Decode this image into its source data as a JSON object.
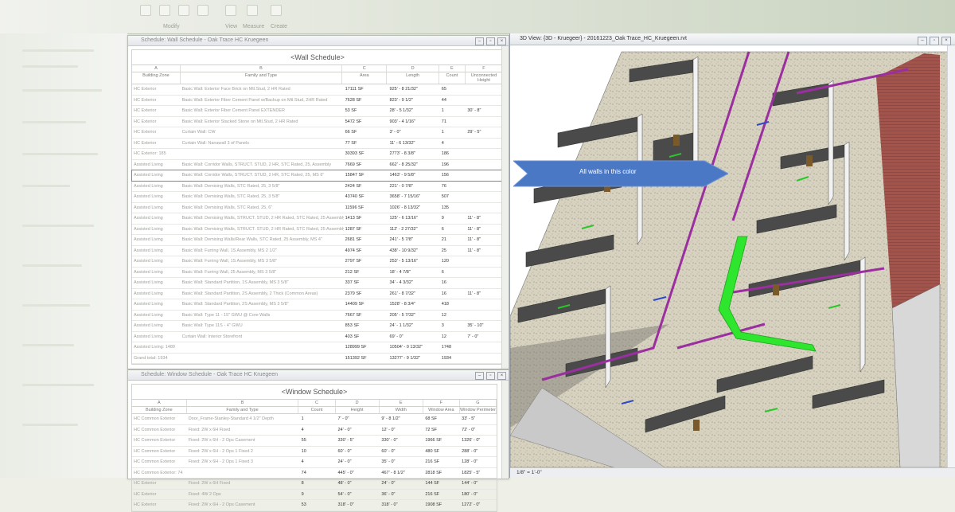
{
  "ribbon": {
    "groups": [
      "Modify",
      "View",
      "Measure",
      "Create"
    ]
  },
  "wall_schedule": {
    "window_title": "Schedule: Wall Schedule - Oak Trace HC Kruegeen",
    "title": "<Wall Schedule>",
    "col_letters": [
      "A",
      "B",
      "C",
      "D",
      "E",
      "F"
    ],
    "headers": [
      "Building Zone",
      "Family and Type",
      "Area",
      "Length",
      "Count",
      "Unconnected Height"
    ],
    "rows": [
      [
        "HC Exterior",
        "Basic Wall: Exterior Face Brick on Mtl.Stud, 2 HR Rated",
        "17111 SF",
        "925' - 8 21/32\"",
        "65",
        ""
      ],
      [
        "HC Exterior",
        "Basic Wall: Exterior Fiber Cement Panel w/Backup on Mtl.Stud, 2HR Rated",
        "7628 SF",
        "823' - 9 1/2\"",
        "44",
        ""
      ],
      [
        "HC Exterior",
        "Basic Wall: Exterior Fiber Cement Panel EXTENDER",
        "53 SF",
        "28' - 5 1/32\"",
        "1",
        "30' - 8\""
      ],
      [
        "HC Exterior",
        "Basic Wall: Exterior Stacked Stone on Mtl.Stud, 2 HR Rated",
        "5472 SF",
        "903' - 4 1/16\"",
        "71",
        ""
      ],
      [
        "HC Exterior",
        "Curtain Wall: CW",
        "66 SF",
        "3' - 0\"",
        "1",
        "29' - 5\""
      ],
      [
        "HC Exterior",
        "Curtain Wall: Nanawall 3 of Panels",
        "77 SF",
        "11' - 6 13/32\"",
        "4",
        ""
      ],
      [
        "HC Exterior: 185",
        "",
        "30393 SF",
        "2773' - 8 3/8\"",
        "186",
        ""
      ],
      [
        "Assisted Living",
        "Basic Wall: Corridor Walls, STRUCT. STUD, 2 HR, STC Rated, 25, Assembly",
        "7669 SF",
        "662' - 8 25/32\"",
        "196",
        ""
      ],
      [
        "Assisted Living",
        "Basic Wall: Corridor Walls, STRUCT. STUD, 2 HR, STC Rated, 25, MS 6\"",
        "15847 SF",
        "1463' - 9 5/8\"",
        "156",
        ""
      ],
      [
        "Assisted Living",
        "Basic Wall: Demising Walls, STC Rated, 25, 3 5/8\"",
        "2424 SF",
        "221' - 0 7/8\"",
        "76",
        ""
      ],
      [
        "Assisted Living",
        "Basic Wall: Demising Walls, STC Rated, 25, 3 5/8\"",
        "43740 SF",
        "3658' - 7 15/16\"",
        "507",
        ""
      ],
      [
        "Assisted Living",
        "Basic Wall: Demising Walls, STC Rated, 25, 6\"",
        "11596 SF",
        "1026' - 8 13/32\"",
        "135",
        ""
      ],
      [
        "Assisted Living",
        "Basic Wall: Demising Walls, STRUCT. STUD, 2 HR Rated, STC Rated, 25 Assembly, MS 3 5/8\"",
        "1413 SF",
        "125' - 6 13/16\"",
        "9",
        "11' - 8\""
      ],
      [
        "Assisted Living",
        "Basic Wall: Demising Walls, STRUCT. STUD, 2 HR Rated, STC Rated, 25 Assembly, MS 3 5/8\"",
        "1287 SF",
        "112' - 2 27/32\"",
        "6",
        "11' - 8\""
      ],
      [
        "Assisted Living",
        "Basic Wall: Demising Walls/Rear Walls, STC Rated, 25 Assembly, MS 4\"",
        "2681 SF",
        "241' - 5 7/8\"",
        "21",
        "11' - 8\""
      ],
      [
        "Assisted Living",
        "Basic Wall: Furring Wall, 1S Assembly, MS 2 1/2\"",
        "4974 SF",
        "438' - 10 9/32\"",
        "25",
        "11' - 8\""
      ],
      [
        "Assisted Living",
        "Basic Wall: Furring Wall, 1S Assembly, MS 3 5/8\"",
        "2797 SF",
        "253' - 5 13/16\"",
        "120",
        ""
      ],
      [
        "Assisted Living",
        "Basic Wall: Furring Wall, 25 Assembly, MS 3 5/8\"",
        "212 SF",
        "18' - 4 7/8\"",
        "6",
        ""
      ],
      [
        "Assisted Living",
        "Basic Wall: Standard Partition, 1S Assembly, MS 3 5/8\"",
        "337 SF",
        "34' - 4 3/32\"",
        "16",
        ""
      ],
      [
        "Assisted Living",
        "Basic Wall: Standard Partition, 2S Assembly, 2 Thick (Common Areas)",
        "2379 SF",
        "261' - 8 7/32\"",
        "16",
        "11' - 8\""
      ],
      [
        "Assisted Living",
        "Basic Wall: Standard Partition, 2S Assembly, MS 3 5/8\"",
        "14409 SF",
        "1528' - 8 3/4\"",
        "418",
        ""
      ],
      [
        "Assisted Living",
        "Basic Wall: Type 11 - 15\" GWU @ Core Walls",
        "7667 SF",
        "205' - 5 7/32\"",
        "12",
        ""
      ],
      [
        "Assisted Living",
        "Basic Wall: Type 11S - 4\" GWU",
        "853 SF",
        "24' - 1 1/32\"",
        "3",
        "35' - 10\""
      ],
      [
        "Assisted Living",
        "Curtain Wall: Interior Storefront",
        "403 SF",
        "69' - 0\"",
        "12",
        "7' - 0\""
      ],
      [
        "Assisted Living: 1489",
        "",
        "128999 SF",
        "10504' - 0 13/32\"",
        "1748",
        ""
      ],
      [
        "Grand total: 1934",
        "",
        "151392 SF",
        "13277' - 9 1/32\"",
        "1934",
        ""
      ]
    ]
  },
  "window_schedule": {
    "window_title": "Schedule: Window Schedule - Oak Trace HC Kruegeen",
    "title": "<Window Schedule>",
    "col_letters": [
      "A",
      "B",
      "C",
      "D",
      "E",
      "F",
      "G"
    ],
    "headers": [
      "Building Zone",
      "Family and Type",
      "Count",
      "Height",
      "Width",
      "Window Area",
      "Window Perimeter"
    ],
    "rows": [
      [
        "HC Common Exterior",
        "Door_Frame-Stanley-Standard 4 1/2\" Depth",
        "1",
        "7' - 0\"",
        "9' - 8 1/2\"",
        "68 SF",
        "33' - 5\""
      ],
      [
        "HC Common Exterior",
        "Fixed: 2W x 6H Fixed",
        "4",
        "24' - 0\"",
        "12' - 0\"",
        "72 SF",
        "72' - 0\""
      ],
      [
        "HC Common Exterior",
        "Fixed: 2W x 6H - 2 Ops Casement",
        "55",
        "330' - 5\"",
        "330' - 0\"",
        "1966 SF",
        "1326' - 0\""
      ],
      [
        "HC Common Exterior",
        "Fixed: 2W x 6H - 2 Ops 1 Fixed 2",
        "10",
        "60' - 0\"",
        "60' - 0\"",
        "480 SF",
        "288' - 0\""
      ],
      [
        "HC Common Exterior",
        "Fixed: 2W x 6H - 2 Ops 1 Fixed 3",
        "4",
        "24' - 0\"",
        "35' - 0\"",
        "216 SF",
        "128' - 0\""
      ],
      [
        "HC Common Exterior: 74",
        "",
        "74",
        "445' - 0\"",
        "467' - 8 1/2\"",
        "2818 SF",
        "1825' - 5\""
      ],
      [
        "HC Exterior",
        "Fixed: 2W x 6H Fixed",
        "8",
        "48' - 0\"",
        "24' - 0\"",
        "144 SF",
        "144' - 0\""
      ],
      [
        "HC Exterior",
        "Fixed: 4W 2 Ops",
        "9",
        "54' - 0\"",
        "36' - 0\"",
        "216 SF",
        "180' - 0\""
      ],
      [
        "HC Exterior",
        "Fixed: 2W x 6H - 2 Ops Casement",
        "53",
        "318' - 0\"",
        "318' - 0\"",
        "1908 SF",
        "1272' - 0\""
      ]
    ]
  },
  "view3d": {
    "title": "3D View: {3D - Kruegeer} - 20161223_Oak Trace_HC_Kruegeen.rvt",
    "status": "1/8\" = 1'-0\"",
    "callout_text": "All walls in this color"
  }
}
